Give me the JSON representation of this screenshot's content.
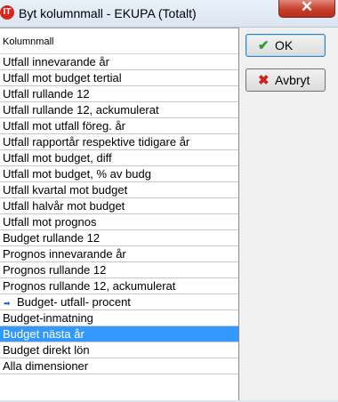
{
  "window": {
    "title": "Byt kolumnmall - EKUPA (Totalt)",
    "icon": "app-logo-icon",
    "close_glyph": "✕"
  },
  "list": {
    "header": "Kolumnmall",
    "rows": [
      {
        "label": "Utfall innevarande år"
      },
      {
        "label": "Utfall mot budget tertial"
      },
      {
        "label": "Utfall rullande 12"
      },
      {
        "label": "Utfall rullande 12, ackumulerat"
      },
      {
        "label": "Utfall mot utfall föreg. år"
      },
      {
        "label": "Utfall rapportår respektive tidigare år"
      },
      {
        "label": "Utfall mot budget, diff"
      },
      {
        "label": "Utfall mot budget, % av budg"
      },
      {
        "label": "Utfall kvartal mot budget"
      },
      {
        "label": "Utfall halvår mot budget"
      },
      {
        "label": "Utfall mot prognos"
      },
      {
        "label": "Budget rullande 12"
      },
      {
        "label": "Prognos innevarande år"
      },
      {
        "label": "Prognos rullande 12"
      },
      {
        "label": "Prognos rullande 12, ackumulerat"
      },
      {
        "label": "Budget- utfall- procent",
        "current": true
      },
      {
        "label": "Budget-inmatning"
      },
      {
        "label": "Budget nästa år",
        "selected": true
      },
      {
        "label": "Budget direkt lön"
      },
      {
        "label": "Alla dimensioner"
      }
    ]
  },
  "buttons": {
    "ok": {
      "label": "OK",
      "icon": "checkmark-icon",
      "icon_color": "#2e9a2e"
    },
    "cancel": {
      "label": "Avbryt",
      "icon": "x-icon",
      "icon_color": "#cc2222"
    }
  }
}
